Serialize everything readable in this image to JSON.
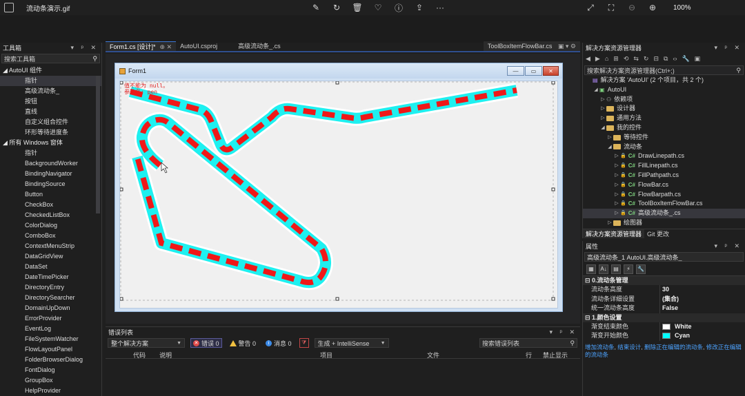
{
  "viewer": {
    "filename": "流动条演示.gif",
    "zoom": "100%",
    "center_icons": [
      "edit-icon",
      "rotate-icon",
      "delete-icon",
      "favorite-icon",
      "info-icon",
      "share-icon",
      "more-icon"
    ],
    "right_icons": [
      "expand-icon",
      "fit-icon",
      "zoom-out-icon",
      "zoom-in-icon"
    ]
  },
  "toolbox": {
    "title": "工具箱",
    "pin": "▾ ᵖ ✕",
    "search_placeholder": "搜索工具箱",
    "items": [
      {
        "label": "◢ AutoUI 组件",
        "kind": "group"
      },
      {
        "label": "指针",
        "kind": "item",
        "selected": true
      },
      {
        "label": "高级流动条_",
        "kind": "item"
      },
      {
        "label": "按钮",
        "kind": "item"
      },
      {
        "label": "直线",
        "kind": "item"
      },
      {
        "label": "自定义组合控件",
        "kind": "item"
      },
      {
        "label": "环形等待进度条",
        "kind": "item"
      },
      {
        "label": "◢ 所有 Windows 窗体",
        "kind": "group"
      },
      {
        "label": "指针",
        "kind": "item"
      },
      {
        "label": "BackgroundWorker",
        "kind": "item"
      },
      {
        "label": "BindingNavigator",
        "kind": "item"
      },
      {
        "label": "BindingSource",
        "kind": "item"
      },
      {
        "label": "Button",
        "kind": "item"
      },
      {
        "label": "CheckBox",
        "kind": "item"
      },
      {
        "label": "CheckedListBox",
        "kind": "item"
      },
      {
        "label": "ColorDialog",
        "kind": "item"
      },
      {
        "label": "ComboBox",
        "kind": "item"
      },
      {
        "label": "ContextMenuStrip",
        "kind": "item"
      },
      {
        "label": "DataGridView",
        "kind": "item"
      },
      {
        "label": "DataSet",
        "kind": "item"
      },
      {
        "label": "DateTimePicker",
        "kind": "item"
      },
      {
        "label": "DirectoryEntry",
        "kind": "item"
      },
      {
        "label": "DirectorySearcher",
        "kind": "item"
      },
      {
        "label": "DomainUpDown",
        "kind": "item"
      },
      {
        "label": "ErrorProvider",
        "kind": "item"
      },
      {
        "label": "EventLog",
        "kind": "item"
      },
      {
        "label": "FileSystemWatcher",
        "kind": "item"
      },
      {
        "label": "FlowLayoutPanel",
        "kind": "item"
      },
      {
        "label": "FolderBrowserDialog",
        "kind": "item"
      },
      {
        "label": "FontDialog",
        "kind": "item"
      },
      {
        "label": "GroupBox",
        "kind": "item"
      },
      {
        "label": "HelpProvider",
        "kind": "item"
      }
    ]
  },
  "editor": {
    "tabs": [
      {
        "label": "Form1.cs [设计]*",
        "active": true,
        "close": "⊕ ✕"
      },
      {
        "label": "AutoUI.csproj",
        "active": false,
        "close": ""
      },
      {
        "label": "高级流动条_.cs",
        "active": false,
        "close": ""
      }
    ],
    "right_tab": "ToolBoxItemFlowBar.cs",
    "right_tab_icons": "▣ ▾ ⚙"
  },
  "form": {
    "title": "Form1",
    "warning_lines": [
      "值不能为 null。",
      "参数名: pen"
    ],
    "buttons": {
      "minimize": "—",
      "maximize": "▭",
      "close": "✕"
    }
  },
  "flowbar": {
    "stroke_color": "#1ef0f0",
    "dash_color": "#f01818"
  },
  "errorlist": {
    "title": "错误列表",
    "pin": "▾ ᵖ ✕",
    "scope": "整个解决方案",
    "errors": "错误 0",
    "warnings": "警告 0",
    "messages": "消息 0",
    "build_filter": "生成 + IntelliSense",
    "search_placeholder": "搜索错误列表",
    "columns": [
      "代码",
      "说明",
      "项目",
      "文件",
      "行",
      "禁止显示"
    ]
  },
  "solution": {
    "title": "解决方案资源管理器",
    "pin": "▾ ᵖ ✕",
    "search_placeholder": "搜索解决方案资源管理器(Ctrl+;)",
    "items": [
      {
        "label": "解决方案 'AutoUI' (2 个项目，共 2 个)",
        "level": 0,
        "type": "solution",
        "caret": ""
      },
      {
        "label": "AutoUI",
        "level": 1,
        "type": "project",
        "caret": "◢"
      },
      {
        "label": "依赖项",
        "level": 2,
        "type": "deps",
        "caret": "▷"
      },
      {
        "label": "设计器",
        "level": 2,
        "type": "folder",
        "caret": "▷"
      },
      {
        "label": "通用方法",
        "level": 2,
        "type": "folder",
        "caret": "▷"
      },
      {
        "label": "我的控件",
        "level": 2,
        "type": "folder",
        "caret": "◢"
      },
      {
        "label": "等待控件",
        "level": 3,
        "type": "folder",
        "caret": "▷"
      },
      {
        "label": "流动条",
        "level": 3,
        "type": "folder",
        "caret": "◢"
      },
      {
        "label": "DrawLinepath.cs",
        "level": 4,
        "type": "cs",
        "caret": "▷"
      },
      {
        "label": "FillLinepath.cs",
        "level": 4,
        "type": "cs",
        "caret": "▷"
      },
      {
        "label": "FillPathpath.cs",
        "level": 4,
        "type": "cs",
        "caret": "▷"
      },
      {
        "label": "FlowBar.cs",
        "level": 4,
        "type": "cs",
        "caret": "▷"
      },
      {
        "label": "FlowBarpath.cs",
        "level": 4,
        "type": "cs",
        "caret": "▷"
      },
      {
        "label": "ToolBoxItemFlowBar.cs",
        "level": 4,
        "type": "cs",
        "caret": "▷"
      },
      {
        "label": "高级流动条_.cs",
        "level": 4,
        "type": "cs",
        "caret": "▷",
        "selected": true
      },
      {
        "label": "绘图器",
        "level": 3,
        "type": "folder",
        "caret": "▷"
      }
    ],
    "tabs": [
      "解决方案资源管理器",
      "Git 更改"
    ]
  },
  "properties": {
    "title": "属性",
    "pin": "▾ ᵖ ✕",
    "object": "高级流动条_1  AutoUI.高级流动条_",
    "categories": [
      {
        "name": "⊟ 0.流动条管理",
        "rows": [
          {
            "name": "流动条高度",
            "value": "30"
          },
          {
            "name": "流动条详细设置",
            "value": "(集合)"
          },
          {
            "name": "统一流动条高度",
            "value": "False"
          }
        ]
      },
      {
        "name": "⊟ 1.颜色设置",
        "rows": [
          {
            "name": "渐变结束颜色",
            "value": "White",
            "swatch": "#ffffff"
          },
          {
            "name": "渐变开始颜色",
            "value": "Cyan",
            "swatch": "#00ffff"
          }
        ]
      }
    ],
    "links": [
      "增加流动条",
      "结束设计",
      "删除正在编辑的流动条",
      "修改正在编辑的流动条"
    ]
  }
}
